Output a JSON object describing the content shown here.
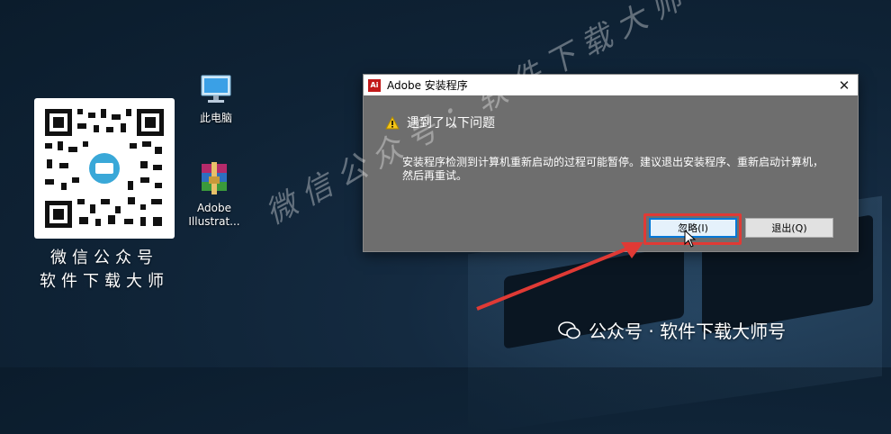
{
  "qr_caption": {
    "line1": "微信公众号",
    "line2": "软件下载大师"
  },
  "desktop_icons": [
    {
      "label": "此电脑",
      "icon": "computer-icon"
    },
    {
      "label_line1": "Adobe",
      "label_line2": "Illustrat...",
      "icon": "winrar-archive-icon"
    }
  ],
  "dialog": {
    "title": "Adobe 安装程序",
    "app_icon_text": "Ai",
    "close_glyph": "✕",
    "heading": "遇到了以下问题",
    "message": "安装程序检测到计算机重新启动的过程可能暂停。建议退出安装程序、重新启动计算机，然后再重试。",
    "buttons": {
      "ignore": "忽略(I)",
      "exit": "退出(Q)"
    }
  },
  "watermarks": {
    "diagonal": "微信公众号：软件下载大师",
    "bottom": "公众号 · 软件下载大师号"
  },
  "colors": {
    "highlight": "#e03a35",
    "dialog_body": "#6e6e6e",
    "primary_button_border": "#0078d7"
  }
}
